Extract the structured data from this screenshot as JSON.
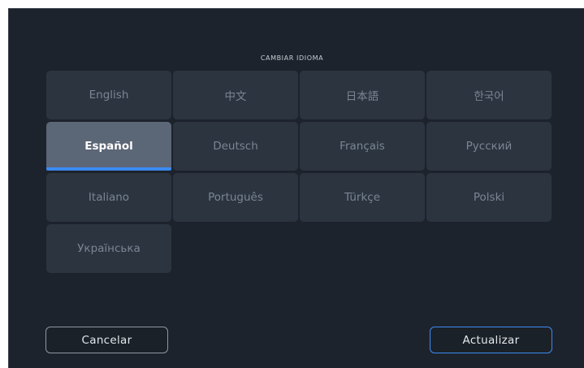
{
  "dialog": {
    "title": "CAMBIAR IDIOMA",
    "languages": [
      "English",
      "中文",
      "日本語",
      "한국어",
      "Español",
      "Deutsch",
      "Français",
      "Русский",
      "Italiano",
      "Português",
      "Türkçe",
      "Polski",
      "Українська"
    ],
    "selected": "Español",
    "cancel_label": "Cancelar",
    "update_label": "Actualizar"
  },
  "colors": {
    "background": "#1d232c",
    "tile": "#2c3440",
    "tile_selected": "#5b6676",
    "accent": "#3b8af2"
  }
}
